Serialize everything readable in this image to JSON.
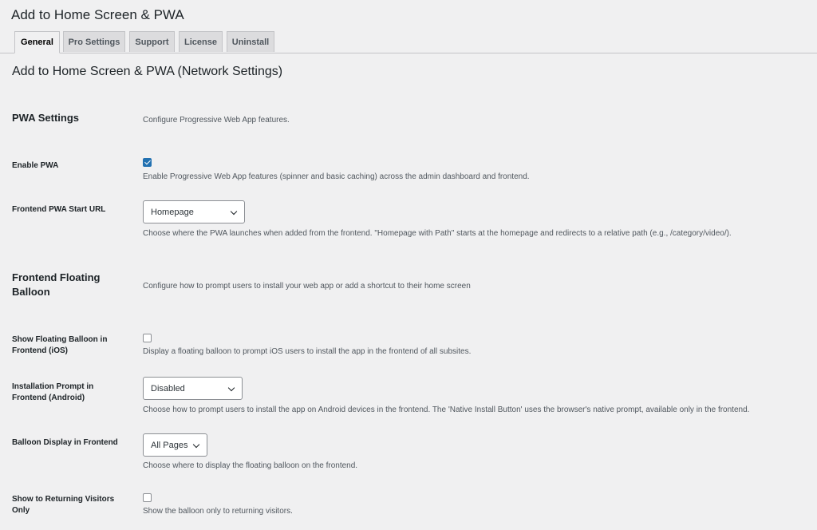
{
  "app": {
    "title": "Add to Home Screen & PWA"
  },
  "tabs": [
    {
      "label": "General",
      "active": true
    },
    {
      "label": "Pro Settings",
      "active": false
    },
    {
      "label": "Support",
      "active": false
    },
    {
      "label": "License",
      "active": false
    },
    {
      "label": "Uninstall",
      "active": false
    }
  ],
  "page": {
    "heading": "Add to Home Screen & PWA (Network Settings)"
  },
  "pwa_section": {
    "title": "PWA Settings",
    "description": "Configure Progressive Web App features.",
    "enable_pwa": {
      "label": "Enable PWA",
      "checked": true,
      "description": "Enable Progressive Web App features (spinner and basic caching) across the admin dashboard and frontend."
    },
    "start_url": {
      "label": "Frontend PWA Start URL",
      "selected": "Homepage",
      "description": "Choose where the PWA launches when added from the frontend. \"Homepage with Path\" starts at the homepage and redirects to a relative path (e.g., /category/video/)."
    }
  },
  "balloon_section": {
    "title": "Frontend Floating Balloon",
    "description": "Configure how to prompt users to install your web app or add a shortcut to their home screen",
    "show_ios": {
      "label": "Show Floating Balloon in Frontend (iOS)",
      "checked": false,
      "description": "Display a floating balloon to prompt iOS users to install the app in the frontend of all subsites."
    },
    "android_prompt": {
      "label": "Installation Prompt in Frontend (Android)",
      "selected": "Disabled",
      "description": "Choose how to prompt users to install the app on Android devices in the frontend. The 'Native Install Button' uses the browser's native prompt, available only in the frontend."
    },
    "display": {
      "label": "Balloon Display in Frontend",
      "selected": "All Pages",
      "description": "Choose where to display the floating balloon on the frontend."
    },
    "returning": {
      "label": "Show to Returning Visitors Only",
      "checked": false,
      "description": "Show the balloon only to returning visitors."
    }
  },
  "colors": {
    "background": "#f0f0f1",
    "accent": "#2271b1",
    "text": "#1d2327",
    "muted_text": "#50575e"
  }
}
